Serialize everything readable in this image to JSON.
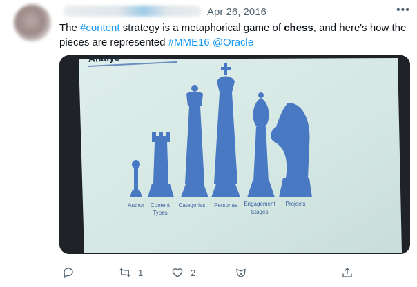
{
  "tweet": {
    "date": "Apr 26, 2016",
    "more_icon": "more-horizontal-icon",
    "text": {
      "p1": "The ",
      "tag_content": "#content",
      "p2": " strategy is a metaphorical game of ",
      "bold": "chess",
      "p3": ", and here's how the pieces are represented ",
      "tag_mme": "#MME16",
      "space": " ",
      "mention": "@Oracle"
    },
    "image": {
      "slide_heading": "Analys",
      "labels": [
        "Author",
        "Content",
        "Types",
        "Categories",
        "Personas",
        "Engagement",
        "Stages",
        "Projects"
      ],
      "colors": {
        "screen": "#d6e8e4",
        "piece": "#4a79c4",
        "bezel": "#1f2328"
      }
    }
  },
  "actions": {
    "reply": {
      "icon": "reply-icon",
      "count": ""
    },
    "retweet": {
      "icon": "retweet-icon",
      "count": "1"
    },
    "like": {
      "icon": "heart-icon",
      "count": "2"
    },
    "save": {
      "icon": "save-icon",
      "count": ""
    },
    "share": {
      "icon": "share-icon",
      "count": ""
    }
  }
}
